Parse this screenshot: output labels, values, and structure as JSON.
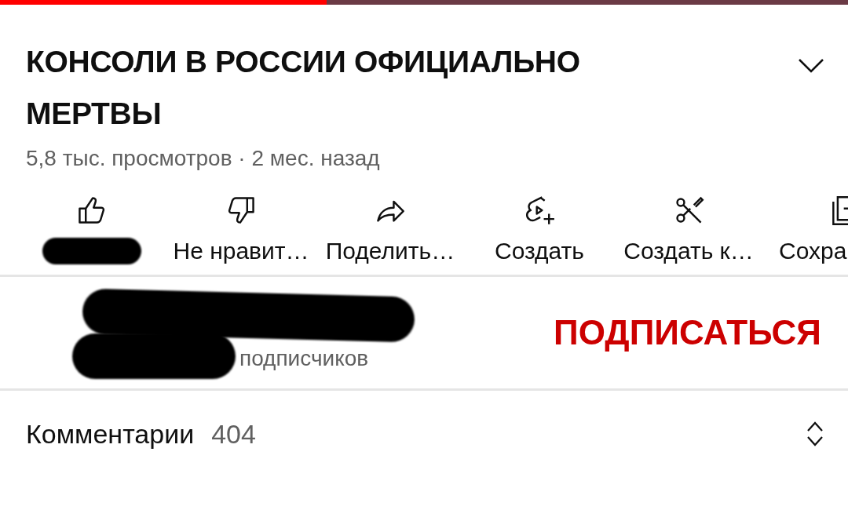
{
  "player": {
    "progress": {
      "level": 0.385
    }
  },
  "video": {
    "title": "КОНСОЛИ В РОССИИ ОФИЦИАЛЬНО МЕРТВЫ",
    "expanded": false,
    "meta": "5,8 тыс. просмотров · 2 мес. назад"
  },
  "actions": [
    {
      "kind": "like",
      "label_redacted": true
    },
    {
      "kind": "dislike",
      "label": "Не нравит…"
    },
    {
      "kind": "share",
      "label": "Поделить…"
    },
    {
      "kind": "create",
      "label": "Создать"
    },
    {
      "kind": "clip",
      "label": "Создать к…"
    },
    {
      "kind": "save",
      "label": "Сохра"
    }
  ],
  "channel": {
    "redacted": true,
    "subscribers": "подписчиков",
    "subscribe_button": "ПОДПИСАТЬСЯ"
  },
  "comments": {
    "label": "Комментарии",
    "count": "404"
  }
}
